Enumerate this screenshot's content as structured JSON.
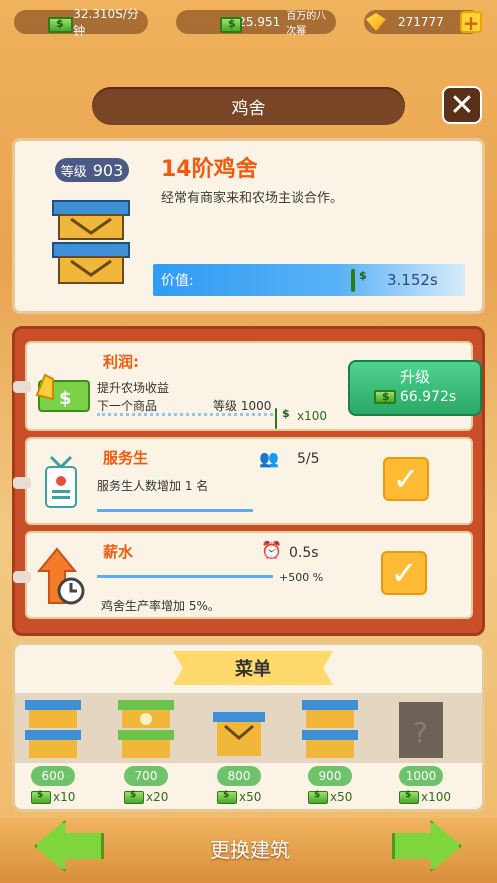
{
  "topbar": {
    "income_rate": "32.310S/分钟",
    "cash": "25.951",
    "cash_unit": "百万的八次幂",
    "gems": "271777"
  },
  "header": {
    "title": "鸡舍",
    "close_label": "✕"
  },
  "building": {
    "level_label": "等级",
    "level": "903",
    "name": "14阶鸡舍",
    "description": "经常有商家来和农场主谈合作。",
    "value_label": "价值:",
    "value": "3.152s"
  },
  "upgrades": {
    "profit": {
      "title": "利润:",
      "subtitle": "提升农场收益",
      "next_label": "下一个商品",
      "next_level": "等级 1000",
      "multiplier": "x100",
      "button_label": "升级",
      "button_cost": "66.972s"
    },
    "waiter": {
      "title": "服务生",
      "count": "5/5",
      "description": "服务生人数增加 1 名"
    },
    "salary": {
      "title": "薪水",
      "time": "0.5s",
      "bonus": "+500 %",
      "description": "鸡舍生产率增加 5%。"
    }
  },
  "menu": {
    "title": "菜单",
    "items": [
      {
        "price": "600",
        "mult": "x10"
      },
      {
        "price": "700",
        "mult": "x20"
      },
      {
        "price": "800",
        "mult": "x50"
      },
      {
        "price": "900",
        "mult": "x50"
      },
      {
        "price": "1000",
        "mult": "x100"
      }
    ]
  },
  "bottom": {
    "switch_label": "更换建筑"
  }
}
